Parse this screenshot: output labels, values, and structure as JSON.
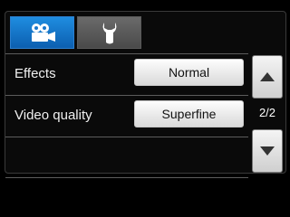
{
  "tabs": [
    {
      "icon": "video-camera-icon",
      "selected": true
    },
    {
      "icon": "wrench-icon",
      "selected": false
    }
  ],
  "settings": [
    {
      "label": "Effects",
      "value": "Normal"
    },
    {
      "label": "Video quality",
      "value": "Superfine"
    }
  ],
  "pager": {
    "text": "2/2"
  },
  "colors": {
    "accent": "#1f8de0",
    "background": "#000000"
  }
}
